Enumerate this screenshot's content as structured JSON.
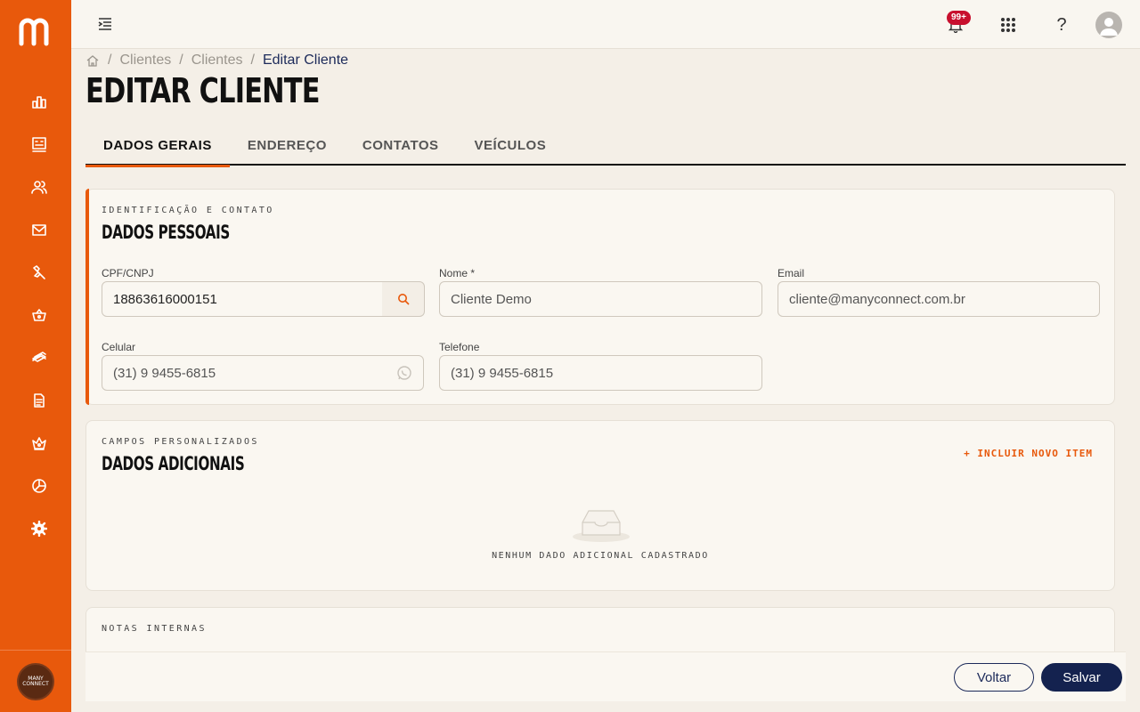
{
  "brand": {
    "logo_letter": "m",
    "footer_logo_text": "MANY CONNECT",
    "accent_color": "#e8590c",
    "primary_color": "#14224f"
  },
  "sidebar": {
    "items": [
      {
        "icon": "bar-chart-icon"
      },
      {
        "icon": "dashboard-icon"
      },
      {
        "icon": "users-icon"
      },
      {
        "icon": "mail-icon"
      },
      {
        "icon": "wrench-icon"
      },
      {
        "icon": "basket-icon"
      },
      {
        "icon": "money-icon"
      },
      {
        "icon": "document-icon"
      },
      {
        "icon": "crown-icon"
      },
      {
        "icon": "pie-chart-icon"
      },
      {
        "icon": "gear-icon"
      }
    ]
  },
  "topbar": {
    "notification_badge": "99+"
  },
  "breadcrumb": {
    "items": [
      "Clientes",
      "Clientes"
    ],
    "current": "Editar Cliente",
    "separator": "/"
  },
  "page": {
    "title": "EDITAR CLIENTE"
  },
  "tabs": [
    {
      "label": "DADOS GERAIS",
      "active": true
    },
    {
      "label": "ENDEREÇO",
      "active": false
    },
    {
      "label": "CONTATOS",
      "active": false
    },
    {
      "label": "VEÍCULOS",
      "active": false
    }
  ],
  "personal": {
    "eyebrow": "IDENTIFICAÇÃO E CONTATO",
    "title": "DADOS PESSOAIS",
    "cpf_label": "CPF/CNPJ",
    "cpf_value": "18863616000151",
    "nome_label": "Nome *",
    "nome_value": "Cliente Demo",
    "email_label": "Email",
    "email_value": "cliente@manyconnect.com.br",
    "celular_label": "Celular",
    "celular_value": "(31) 9 9455-6815",
    "telefone_label": "Telefone",
    "telefone_value": "(31) 9 9455-6815"
  },
  "additional": {
    "eyebrow": "CAMPOS PERSONALIZADOS",
    "title": "DADOS ADICIONAIS",
    "include_label": "+ INCLUIR NOVO ITEM",
    "empty_text": "NENHUM DADO ADICIONAL CADASTRADO"
  },
  "notes": {
    "eyebrow": "NOTAS INTERNAS"
  },
  "footer": {
    "back_label": "Voltar",
    "save_label": "Salvar"
  }
}
